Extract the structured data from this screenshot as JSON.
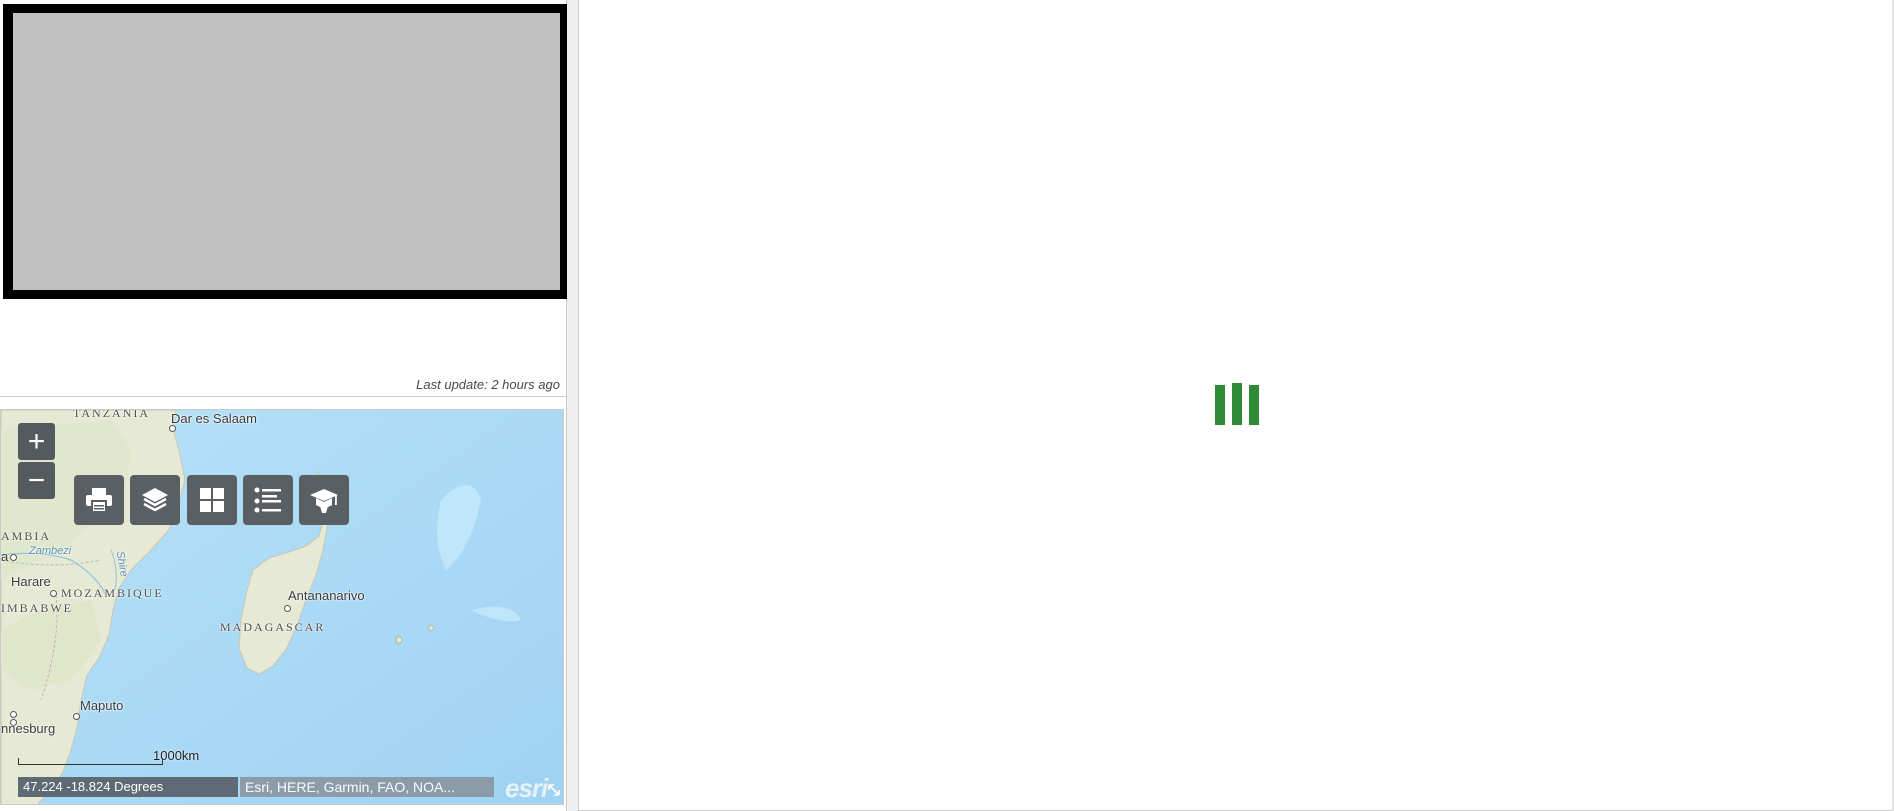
{
  "media_panel": {
    "last_update": "Last update: 2 hours ago"
  },
  "map": {
    "labels": {
      "tanzania": "TANZANIA",
      "dar_es_salaam": "Dar es Salaam",
      "zambia": "AMBIA",
      "zambezi": "Zambezi",
      "shire": "Shire",
      "harare": "Harare",
      "mozambique": "MOZAMBIQUE",
      "zimbabwe": "IMBABWE",
      "antananarivo": "Antananarivo",
      "madagascar": "MADAGASCAR",
      "maputo": "Maputo",
      "johannesburg": "nnesburg",
      "ambia_suffix": "a"
    },
    "zoom_in_label": "+",
    "zoom_out_label": "−",
    "toolbar": [
      {
        "name": "print",
        "icon": "printer-icon"
      },
      {
        "name": "layers",
        "icon": "layers-icon"
      },
      {
        "name": "basemap",
        "icon": "grid-icon"
      },
      {
        "name": "legend",
        "icon": "list-icon"
      },
      {
        "name": "about",
        "icon": "mortarboard-icon"
      }
    ],
    "scale_label": "1000km",
    "coordinates": "47.224 -18.824 Degrees",
    "attribution": "Esri, HERE, Garmin, FAO, NOA...",
    "logo_text": "esri"
  },
  "colors": {
    "loader_green": "#2e8b35",
    "map_button": "#5a5f64",
    "ocean": "#a9d9f5",
    "land": "#e8ead5"
  }
}
